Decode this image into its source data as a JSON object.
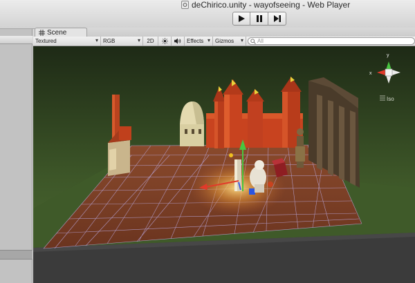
{
  "window": {
    "title": "deChirico.unity - wayofseeing - Web Player"
  },
  "playbar": {
    "play_label": "▶",
    "pause_label": "❚❚",
    "step_label": "▶❙"
  },
  "tab": {
    "label": "Scene"
  },
  "toolbar": {
    "render_mode": "Textured",
    "color_mode": "RGB",
    "mode_2d": "2D",
    "effects": "Effects",
    "gizmos": "Gizmos",
    "search_placeholder": "All"
  },
  "scene": {
    "projection_label": "Iso",
    "gizmo_axes": {
      "x": "x",
      "y": "y"
    },
    "colors": {
      "sky_top": "#243219",
      "sky_bottom": "#4f6e34",
      "ground": "#3a4f25",
      "floor": "#7c4027",
      "grid": "#b8a8e0",
      "castle": "#c8431f",
      "road": "#3c3c3c"
    }
  }
}
